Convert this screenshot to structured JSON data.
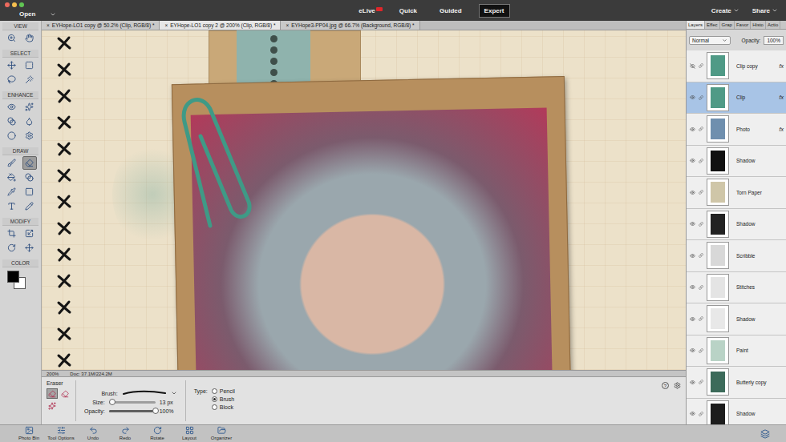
{
  "window": {
    "controls": [
      {
        "color": "#ed6a5e"
      },
      {
        "color": "#f5bf4f"
      },
      {
        "color": "#61c554"
      }
    ]
  },
  "topbar": {
    "open": "Open",
    "elive": "eLive",
    "modes": [
      {
        "label": "Quick",
        "selected": false
      },
      {
        "label": "Guided",
        "selected": false
      },
      {
        "label": "Expert",
        "selected": true
      }
    ],
    "actions": [
      "Create",
      "Share"
    ]
  },
  "doc_tabs": {
    "close": "×",
    "items": [
      {
        "label": "EYHope-LO1 copy @ 50.2% (Clip, RGB/8) *",
        "selected": false
      },
      {
        "label": "EYHope-LO1 copy 2 @ 200% (Clip, RGB/8) *",
        "selected": true
      },
      {
        "label": "EYHope3-PP04.jpg @ 66.7% (Background, RGB/8) *",
        "selected": false
      }
    ]
  },
  "toolbar": {
    "sections": [
      {
        "label": "VIEW",
        "tools": [
          {
            "kind": "zoom",
            "selected": false
          },
          {
            "kind": "hand",
            "selected": false
          }
        ]
      },
      {
        "label": "SELECT",
        "tools": [
          {
            "kind": "move",
            "selected": false
          },
          {
            "kind": "marquee",
            "selected": false
          },
          {
            "kind": "lasso",
            "selected": false
          },
          {
            "kind": "wand",
            "selected": false
          }
        ]
      },
      {
        "label": "ENHANCE",
        "tools": [
          {
            "kind": "red-eye",
            "selected": false
          },
          {
            "kind": "heal",
            "selected": false
          },
          {
            "kind": "smart-brush",
            "selected": false
          },
          {
            "kind": "blur",
            "selected": false
          },
          {
            "kind": "sponge",
            "selected": false
          },
          {
            "kind": "clone",
            "selected": false
          }
        ]
      },
      {
        "label": "DRAW",
        "tools": [
          {
            "kind": "brush",
            "selected": false
          },
          {
            "kind": "eraser",
            "selected": true
          },
          {
            "kind": "bucket",
            "selected": false
          },
          {
            "kind": "gradient",
            "selected": false
          },
          {
            "kind": "eyedropper",
            "selected": false
          },
          {
            "kind": "shape",
            "selected": false
          },
          {
            "kind": "type",
            "selected": false
          },
          {
            "kind": "pencil",
            "selected": false
          }
        ]
      },
      {
        "label": "MODIFY",
        "tools": [
          {
            "kind": "crop",
            "selected": false
          },
          {
            "kind": "recompose",
            "selected": false
          },
          {
            "kind": "straighten",
            "selected": false
          },
          {
            "kind": "content-move",
            "selected": false
          }
        ]
      }
    ],
    "color_label": "COLOR",
    "swatches": [
      {
        "color": "#000000"
      },
      {
        "color": "#ffffff"
      }
    ]
  },
  "status": {
    "zoom": "200%",
    "doc": "Doc: 37.1M/224.2M"
  },
  "tool_options": {
    "tool": "Eraser",
    "presets": [
      {
        "kind": "eraser",
        "selected": true
      },
      {
        "kind": "background-eraser",
        "selected": false
      },
      {
        "kind": "magic-eraser",
        "selected": false
      }
    ],
    "brush_label": "Brush:",
    "size": {
      "label": "Size:",
      "level": 0.08,
      "reading": "13 px"
    },
    "opacity": {
      "label": "Opacity:",
      "level": 1,
      "reading": "100%"
    },
    "type": {
      "label": "Type:",
      "options": [
        {
          "label": "Pencil",
          "selected": false
        },
        {
          "label": "Brush",
          "selected": true
        },
        {
          "label": "Block",
          "selected": false
        }
      ]
    },
    "help": "?"
  },
  "panel": {
    "tabs": [
      {
        "label": "Layers",
        "selected": true
      },
      {
        "label": "Effec",
        "selected": false
      },
      {
        "label": "Grap",
        "selected": false
      },
      {
        "label": "Favor",
        "selected": false
      },
      {
        "label": "Histo",
        "selected": false
      },
      {
        "label": "Actio",
        "selected": false
      }
    ],
    "blend": "Normal",
    "opacity_label": "Opacity:",
    "opacity": "100%",
    "fx_label": "fx",
    "layers": [
      {
        "name": "Clip copy",
        "visible": false,
        "selected": false,
        "fx": true,
        "color": "#4f9a86"
      },
      {
        "name": "Clip",
        "visible": true,
        "selected": true,
        "fx": true,
        "color": "#4f9a86"
      },
      {
        "name": "Photo",
        "visible": true,
        "selected": false,
        "fx": true,
        "color": "#6f8fae"
      },
      {
        "name": "Shadow",
        "visible": true,
        "selected": false,
        "fx": false,
        "color": "#111111"
      },
      {
        "name": "Torn Paper",
        "visible": true,
        "selected": false,
        "fx": false,
        "color": "#cfc6a8"
      },
      {
        "name": "Shadow",
        "visible": true,
        "selected": false,
        "fx": false,
        "color": "#222222"
      },
      {
        "name": "Scribble",
        "visible": true,
        "selected": false,
        "fx": false,
        "color": "#d8d8d8"
      },
      {
        "name": "Stitches",
        "visible": true,
        "selected": false,
        "fx": false,
        "color": "#e4e4e4"
      },
      {
        "name": "Shadow",
        "visible": true,
        "selected": false,
        "fx": false,
        "color": "#e8e8e8"
      },
      {
        "name": "Paint",
        "visible": true,
        "selected": false,
        "fx": false,
        "color": "#b9d3c6"
      },
      {
        "name": "Butterly copy",
        "visible": true,
        "selected": false,
        "fx": false,
        "color": "#3c6b5a"
      },
      {
        "name": "Shadow",
        "visible": true,
        "selected": false,
        "fx": false,
        "color": "#1d1d1d"
      }
    ]
  },
  "taskbar": {
    "items": [
      {
        "label": "Photo Bin",
        "kind": "photo-bin"
      },
      {
        "label": "Tool Options",
        "kind": "tool-options"
      },
      {
        "label": "Undo",
        "kind": "undo"
      },
      {
        "label": "Redo",
        "kind": "redo"
      },
      {
        "label": "Rotate",
        "kind": "rotate"
      },
      {
        "label": "Layout",
        "kind": "layout"
      },
      {
        "label": "Organizer",
        "kind": "organizer"
      }
    ]
  }
}
